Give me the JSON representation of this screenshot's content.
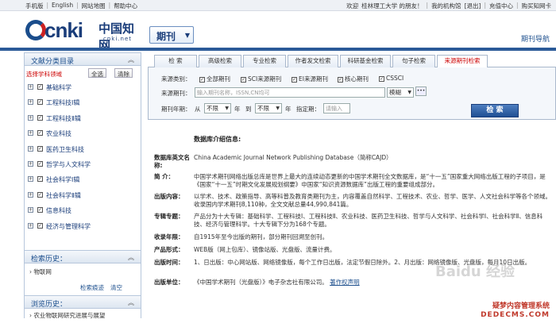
{
  "topbar": {
    "left": [
      "手机版",
      "English",
      "网站地图",
      "帮助中心"
    ],
    "right": [
      "欢迎",
      "桂林理工大学 的朋友！",
      "我的机构馆",
      "退出",
      "充值中心",
      "购买知网卡"
    ]
  },
  "header": {
    "logo_text": "cnki",
    "logo_cn": "中国知网",
    "logo_net": "cnki.net",
    "dropdown_label": "期刊",
    "journal_nav": "期刊导航"
  },
  "sidebar": {
    "subject_title": "文献分类目录",
    "pick_label": "选择学科领域",
    "select_all": "全选",
    "clear": "清除",
    "subjects": [
      "基础科学",
      "工程科技Ⅰ辑",
      "工程科技Ⅱ辑",
      "农业科技",
      "医药卫生科技",
      "哲学与人文科学",
      "社会科学Ⅰ辑",
      "社会科学Ⅱ辑",
      "信息科技",
      "经济与管理科学"
    ],
    "history_title": "检索历史：",
    "history_item": "物联网",
    "history_links": [
      "检索痕迹",
      "清空"
    ],
    "browse_title": "浏览历史：",
    "browse_item": "农业物联网研究进展与展望"
  },
  "tabs": [
    "检 索",
    "高级检索",
    "专业检索",
    "作者发文检索",
    "科研基金检索",
    "句子检索",
    "来源期刊检索"
  ],
  "search": {
    "source_type_label": "来源类别：",
    "source_types": [
      "全部期刊",
      "SCI来源期刊",
      "EI来源期刊",
      "核心期刊",
      "CSSCI"
    ],
    "journal_label": "来源期刊：",
    "journal_placeholder": "输入期刊名称，ISSN,CN均可",
    "match_mode": "模糊",
    "year_label": "期刊年期：",
    "from_label": "从",
    "from_value": "不限",
    "year_unit_1": "年",
    "to_label": "到",
    "to_value": "不限",
    "year_unit_2": "年",
    "issue_label": "指定期：",
    "issue_placeholder": "请输入",
    "search_button": "检 索"
  },
  "info": {
    "title": "数据库介绍信息:",
    "rows": [
      {
        "k": "数据库英文名称:",
        "v": "China Academic Journal Network Publishing Database（简称CAJD）"
      },
      {
        "k": "简    介：",
        "v": "中国学术期刊网络出版总库是世界上最大的连续动态更新的中国学术期刊全文数据库，是“十一五”国家重大网络出版工程的子项目，是《国家“十一五”时期文化发展规划纲要》中国家“知识资源数据库”出版工程的重要组成部分。"
      },
      {
        "k": "出版内容：",
        "v": "以学术、技术、政策指导、高等科普及教育类期刊为主，内容覆盖自然科学、工程技术、农业、哲学、医学、人文社会科学等各个领域。收录国内学术期刊8,110种，全文文献总量44,990,841篇。"
      },
      {
        "k": "专辑专题：",
        "v": "产品分为十大专辑：基础科学、工程科技Ⅰ、工程科技Ⅱ、农业科技、医药卫生科技、哲学与人文科学、社会科学Ⅰ、社会科学Ⅱ、信息科技、经济与管理科学。十大专辑下分为168个专题。"
      },
      {
        "k": "收录年限：",
        "v": "自1915年至今出版的期刊，部分期刊回溯至创刊。"
      },
      {
        "k": "产品形式：",
        "v": "WEB版（网上包库）、镜像站版、光盘版、流量计费。"
      },
      {
        "k": "出版时间：",
        "v": "1、日出版：中心网站版、网络镜像版，每个工作日出版，法定节假日除外。2、月出版：网络镜像版、光盘版，每月10日出版。"
      },
      {
        "k": "出版单位：",
        "v": "《中国学术期刊（光盘版）》电子杂志社有限公司。"
      }
    ],
    "copyright_link": "著作权声明"
  },
  "watermark": {
    "baidu": "Baidu 经验",
    "site": "疑梦内容管理系统",
    "url": "DEDECMS.COM"
  }
}
